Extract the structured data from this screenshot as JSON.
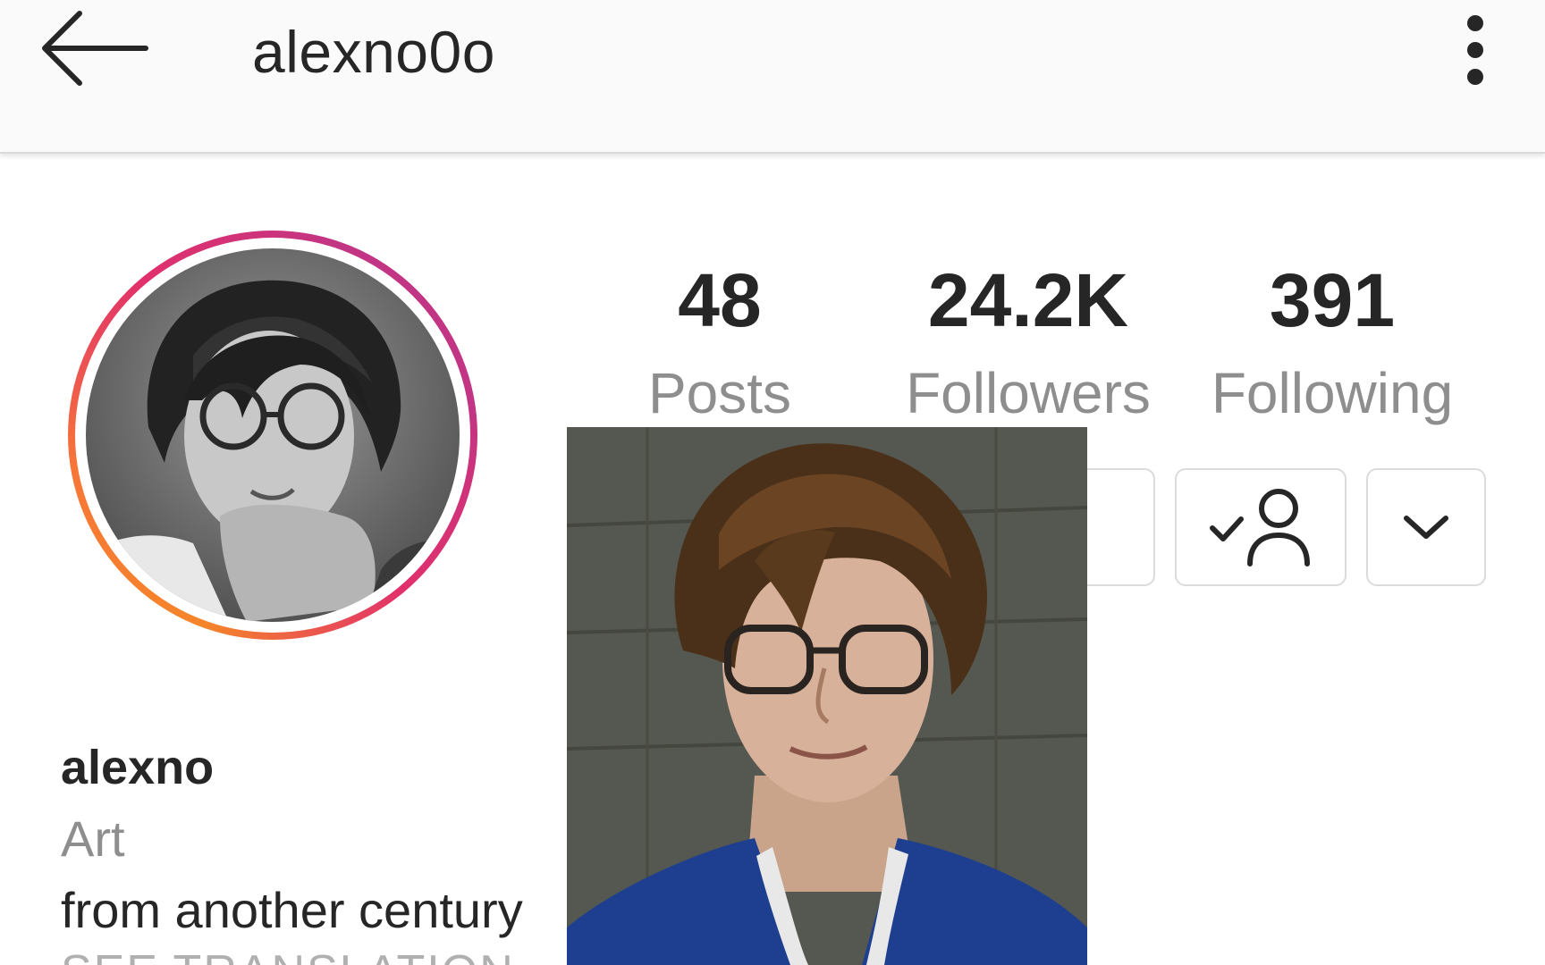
{
  "header": {
    "username": "alexno0o",
    "back_icon": "arrow-left-icon",
    "more_icon": "vertical-dots-icon"
  },
  "profile": {
    "avatar_ring_colors": [
      "#f58529",
      "#e1306c",
      "#c13584"
    ]
  },
  "stats": {
    "posts": {
      "value": "48",
      "label": "Posts"
    },
    "followers": {
      "value": "24.2K",
      "label": "Followers"
    },
    "following": {
      "value": "391",
      "label": "Following"
    }
  },
  "actions": {
    "following_icon": "user-check-icon",
    "suggest_icon": "chevron-down-icon"
  },
  "bio": {
    "name": "alexno",
    "category": "Art",
    "text": "from another century",
    "translate_link": "SEE TRANSLATION"
  },
  "colors": {
    "text_primary": "#262626",
    "text_secondary": "#8e8e8e",
    "border": "#dbdbdb",
    "appbar_bg": "#fafafa"
  }
}
